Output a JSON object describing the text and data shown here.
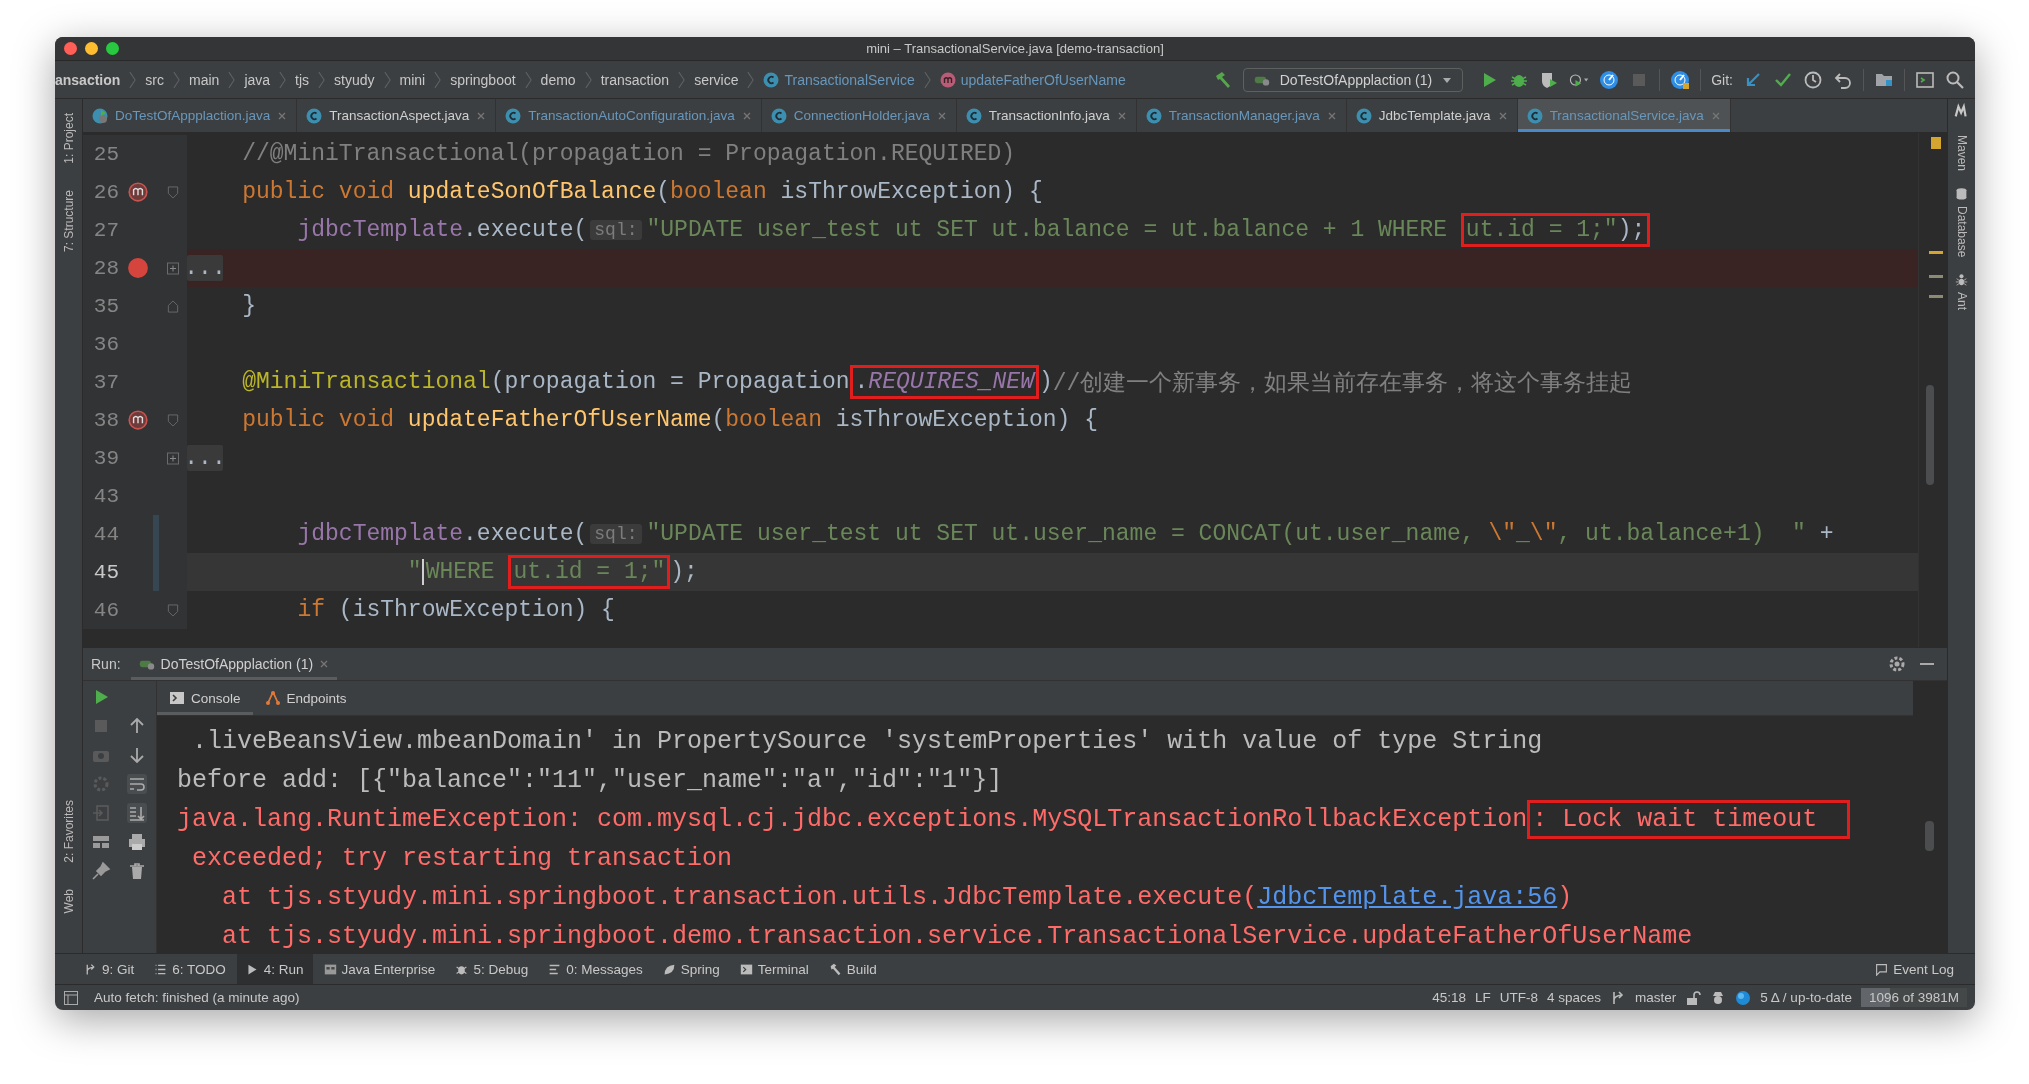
{
  "window": {
    "title": "mini – TransactionalService.java [demo-transaction]"
  },
  "breadcrumbs": [
    {
      "label": "ansaction",
      "kind": "root"
    },
    {
      "label": "src",
      "kind": "folder"
    },
    {
      "label": "main",
      "kind": "folder"
    },
    {
      "label": "java",
      "kind": "folder"
    },
    {
      "label": "tjs",
      "kind": "folder"
    },
    {
      "label": "styudy",
      "kind": "folder"
    },
    {
      "label": "mini",
      "kind": "folder"
    },
    {
      "label": "springboot",
      "kind": "folder"
    },
    {
      "label": "demo",
      "kind": "folder"
    },
    {
      "label": "transaction",
      "kind": "folder"
    },
    {
      "label": "service",
      "kind": "folder"
    },
    {
      "label": "TransactionalService",
      "kind": "class"
    },
    {
      "label": "updateFatherOfUserName",
      "kind": "method"
    }
  ],
  "toolbar": {
    "run_configuration": "DoTestOfAppplaction (1)",
    "git_label": "Git:"
  },
  "tabs": [
    {
      "label": "DoTestOfAppplaction.java",
      "kind": "runner",
      "vcs_modified": true,
      "selected": false
    },
    {
      "label": "TransactionAspect.java",
      "kind": "class",
      "vcs_modified": false,
      "selected": false
    },
    {
      "label": "TransactionAutoConfiguration.java",
      "kind": "class",
      "vcs_modified": true,
      "selected": false
    },
    {
      "label": "ConnectionHolder.java",
      "kind": "class",
      "vcs_modified": true,
      "selected": false
    },
    {
      "label": "TransactionInfo.java",
      "kind": "class",
      "vcs_modified": false,
      "selected": false
    },
    {
      "label": "TransactionManager.java",
      "kind": "class",
      "vcs_modified": true,
      "selected": false
    },
    {
      "label": "JdbcTemplate.java",
      "kind": "class",
      "vcs_modified": false,
      "selected": false
    },
    {
      "label": "TransactionalService.java",
      "kind": "class",
      "vcs_modified": true,
      "selected": true
    }
  ],
  "left_tool_strip": {
    "top": [
      "1: Project",
      "7: Structure"
    ],
    "bottom": [
      "2: Favorites",
      "Web"
    ]
  },
  "right_tool_strip": [
    {
      "label": "Maven",
      "kind": "maven"
    },
    {
      "label": "Database",
      "kind": "database"
    },
    {
      "label": "Ant",
      "kind": "ant"
    }
  ],
  "code_lines": [
    {
      "number": "25",
      "tokens": [
        {
          "text": "    //@MiniTransactional(propagation = Propagation.REQUIRED)",
          "kind": "comment"
        }
      ]
    },
    {
      "number": "26",
      "override": true,
      "fold_start": true,
      "tokens": [
        {
          "text": "    public void ",
          "kind": "keyword"
        },
        {
          "text": "updateSonOfBalance",
          "kind": "method"
        },
        {
          "text": "(",
          "kind": "plain"
        },
        {
          "text": "boolean",
          "kind": "keyword"
        },
        {
          "text": " isThrowException) {",
          "kind": "plain"
        }
      ]
    },
    {
      "number": "27",
      "tokens": [
        {
          "text": "        jdbcTemplate",
          "kind": "field"
        },
        {
          "text": ".execute(",
          "kind": "plain"
        },
        {
          "text": "sql:",
          "kind": "hint"
        },
        {
          "text": "\"UPDATE user_test ut SET ut.balance = ut.balance + 1 WHERE ",
          "kind": "string"
        },
        {
          "text": "ut.id = 1;\"",
          "kind": "string",
          "boxed": true
        },
        {
          "text": ");",
          "kind": "plain",
          "boxed": true
        }
      ]
    },
    {
      "number": "28",
      "breakpoint": true,
      "collapsed": true,
      "tokens": [
        {
          "text": "...",
          "kind": "fold"
        }
      ]
    },
    {
      "number": "35",
      "fold_end": true,
      "tokens": [
        {
          "text": "    }",
          "kind": "plain"
        }
      ]
    },
    {
      "number": "36"
    },
    {
      "number": "37",
      "tokens": [
        {
          "text": "    @MiniTransactional",
          "kind": "annotation"
        },
        {
          "text": "(propagation = Propagation",
          "kind": "plain"
        },
        {
          "text": ".",
          "kind": "plain",
          "boxed": true
        },
        {
          "text": "REQUIRES_NEW",
          "kind": "constant",
          "boxed": true
        },
        {
          "text": ")",
          "kind": "plain"
        },
        {
          "text": "//创建一个新事务，如果当前存在事务，将这个事务挂起",
          "kind": "comment"
        }
      ]
    },
    {
      "number": "38",
      "override": true,
      "fold_start": true,
      "tokens": [
        {
          "text": "    public void ",
          "kind": "keyword"
        },
        {
          "text": "updateFatherOfUserName",
          "kind": "method"
        },
        {
          "text": "(",
          "kind": "plain"
        },
        {
          "text": "boolean",
          "kind": "keyword"
        },
        {
          "text": " isThrowException) {",
          "kind": "plain"
        }
      ]
    },
    {
      "number": "39",
      "collapsed": true,
      "tokens": [
        {
          "text": "...",
          "kind": "fold"
        }
      ]
    },
    {
      "number": "43"
    },
    {
      "number": "44",
      "changed": true,
      "tokens": [
        {
          "text": "        jdbcTemplate",
          "kind": "field"
        },
        {
          "text": ".execute(",
          "kind": "plain"
        },
        {
          "text": "sql:",
          "kind": "hint"
        },
        {
          "text": "\"UPDATE user_test ut SET ut.user_name = CONCAT(ut.user_name, ",
          "kind": "string"
        },
        {
          "text": "\\\"",
          "kind": "escape"
        },
        {
          "text": "_",
          "kind": "string"
        },
        {
          "text": "\\\"",
          "kind": "escape"
        },
        {
          "text": ", ut.balance+1)  \"",
          "kind": "string"
        },
        {
          "text": " +",
          "kind": "plain"
        }
      ]
    },
    {
      "number": "45",
      "changed": true,
      "current": true,
      "tokens": [
        {
          "text": "                \"",
          "kind": "string"
        },
        {
          "text": "WHERE ",
          "kind": "string",
          "caret": true
        },
        {
          "text": "ut.id = 1;\"",
          "kind": "string",
          "boxed": true
        },
        {
          "text": ");",
          "kind": "plain"
        }
      ]
    },
    {
      "number": "46",
      "fold_start": true,
      "tokens": [
        {
          "text": "        if",
          "kind": "keyword"
        },
        {
          "text": " (isThrowException) {",
          "kind": "plain"
        }
      ]
    }
  ],
  "run_panel": {
    "label": "Run:",
    "tab": "DoTestOfAppplaction (1)",
    "console_tabs": [
      {
        "label": "Console",
        "selected": true,
        "kind": "console"
      },
      {
        "label": "Endpoints",
        "selected": false,
        "kind": "endpoints"
      }
    ],
    "lines": [
      [
        {
          "text": " .liveBeansView.mbeanDomain' in PropertySource 'systemProperties' with value of type String",
          "kind": "plain"
        }
      ],
      [
        {
          "text": "before add: [{\"balance\":\"11\",\"user_name\":\"a\",\"id\":\"1\"}]",
          "kind": "plain"
        }
      ],
      [
        {
          "text": "java.lang.RuntimeException: com.mysql.cj.jdbc.exceptions.MySQLTransactionRollbackException",
          "kind": "error"
        },
        {
          "text": ": Lock wait timeout",
          "kind": "error",
          "boxed": true
        }
      ],
      [
        {
          "text": " exceeded; try restarting transaction",
          "kind": "error"
        }
      ],
      [
        {
          "text": "   at tjs.styudy.mini.springboot.transaction.utils.JdbcTemplate.execute(",
          "kind": "error"
        },
        {
          "text": "JdbcTemplate.java:56",
          "kind": "link"
        },
        {
          "text": ")",
          "kind": "error"
        }
      ],
      [
        {
          "text": "   at tjs.styudy.mini.springboot.demo.transaction.service.TransactionalService.updateFatherOfUserName",
          "kind": "error"
        }
      ]
    ]
  },
  "tool_windows": [
    {
      "label": "9: Git",
      "kind": "git",
      "selected": false
    },
    {
      "label": "6: TODO",
      "kind": "todo",
      "selected": false
    },
    {
      "label": "4: Run",
      "kind": "run",
      "selected": true
    },
    {
      "label": "Java Enterprise",
      "kind": "enterprise",
      "selected": false
    },
    {
      "label": "5: Debug",
      "kind": "debug",
      "selected": false
    },
    {
      "label": "0: Messages",
      "kind": "messages",
      "selected": false
    },
    {
      "label": "Spring",
      "kind": "spring",
      "selected": false
    },
    {
      "label": "Terminal",
      "kind": "terminal",
      "selected": false
    },
    {
      "label": "Build",
      "kind": "build",
      "selected": false
    }
  ],
  "event_log": "Event Log",
  "status_bar": {
    "message": "Auto fetch: finished (a minute ago)",
    "position": "45:18",
    "line_separator": "LF",
    "encoding": "UTF-8",
    "indent": "4 spaces",
    "branch": "master",
    "vcs_status": "5 Δ / up-to-date",
    "memory": {
      "text": "1096 of 3981M",
      "level": 0.275
    }
  }
}
